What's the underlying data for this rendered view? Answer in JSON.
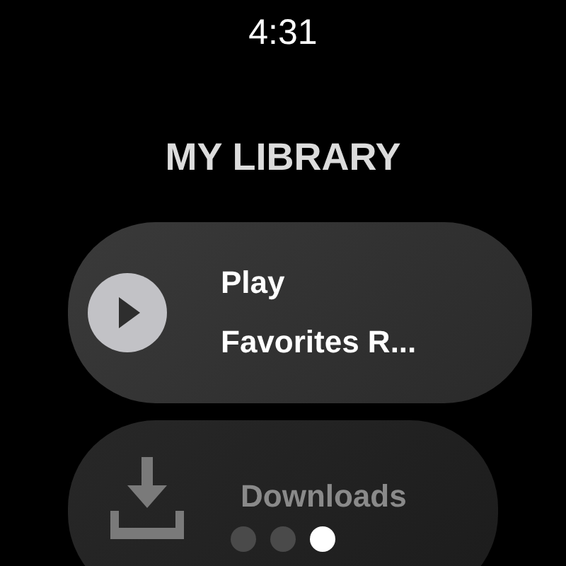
{
  "status_bar": {
    "time": "4:31"
  },
  "title": "MY LIBRARY",
  "items": [
    {
      "kind": "play",
      "lines": [
        "Play",
        "Favorites R..."
      ]
    },
    {
      "kind": "download",
      "lines": [
        "Downloads"
      ]
    }
  ],
  "page_indicator": [
    {
      "selected": false
    },
    {
      "selected": false
    },
    {
      "selected": true
    }
  ]
}
